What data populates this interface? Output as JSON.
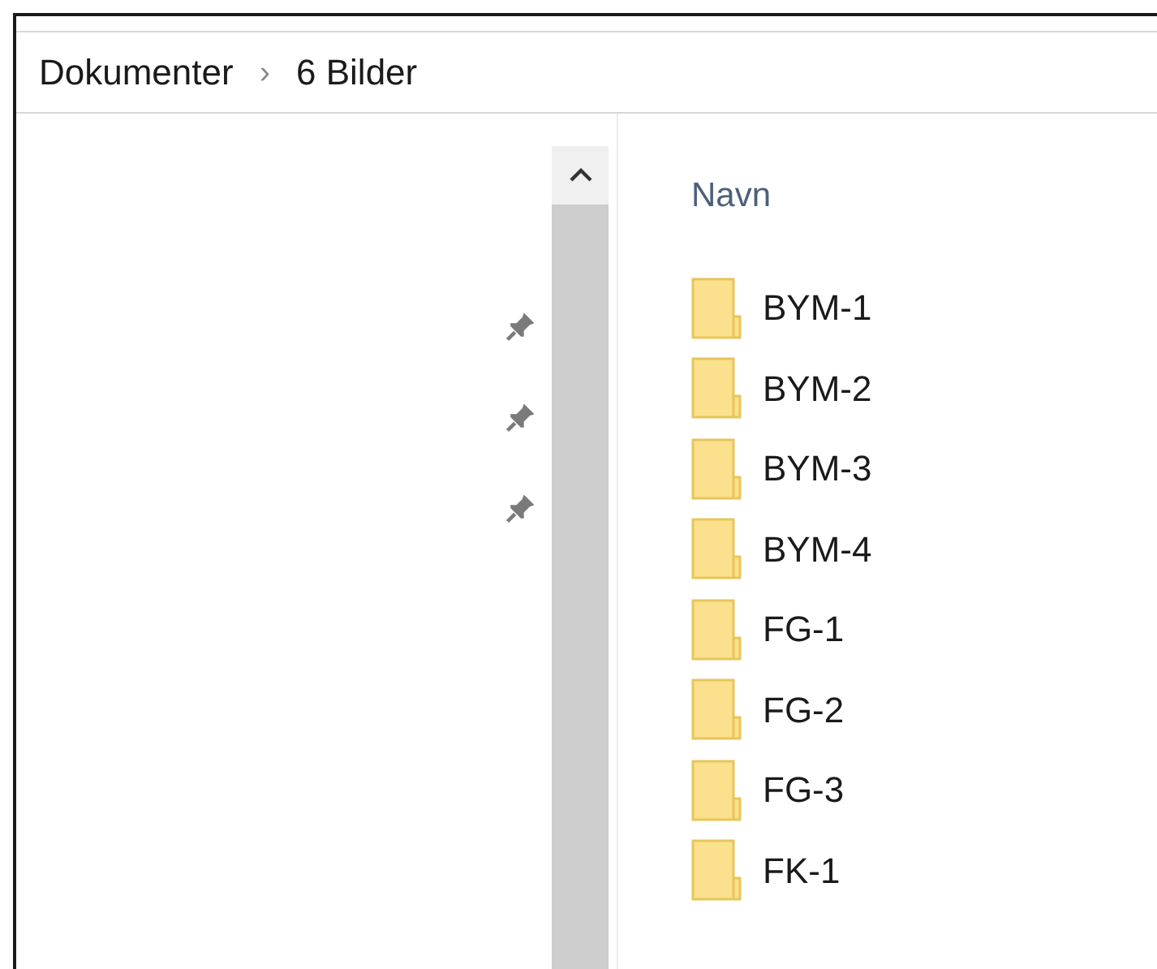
{
  "breadcrumb": [
    {
      "label": "Dokumenter"
    },
    {
      "label": "6 Bilder"
    }
  ],
  "separator": "›",
  "navigation_pane": {
    "items": [
      {
        "pinned": true
      },
      {
        "pinned": true
      },
      {
        "pinned": true
      }
    ]
  },
  "file_list": {
    "column_header": "Navn",
    "items": [
      {
        "name": "BYM-1",
        "kind": "folder"
      },
      {
        "name": "BYM-2",
        "kind": "folder"
      },
      {
        "name": "BYM-3",
        "kind": "folder"
      },
      {
        "name": "BYM-4",
        "kind": "folder"
      },
      {
        "name": "FG-1",
        "kind": "folder"
      },
      {
        "name": "FG-2",
        "kind": "folder"
      },
      {
        "name": "FG-3",
        "kind": "folder"
      },
      {
        "name": "FK-1",
        "kind": "folder"
      }
    ]
  }
}
